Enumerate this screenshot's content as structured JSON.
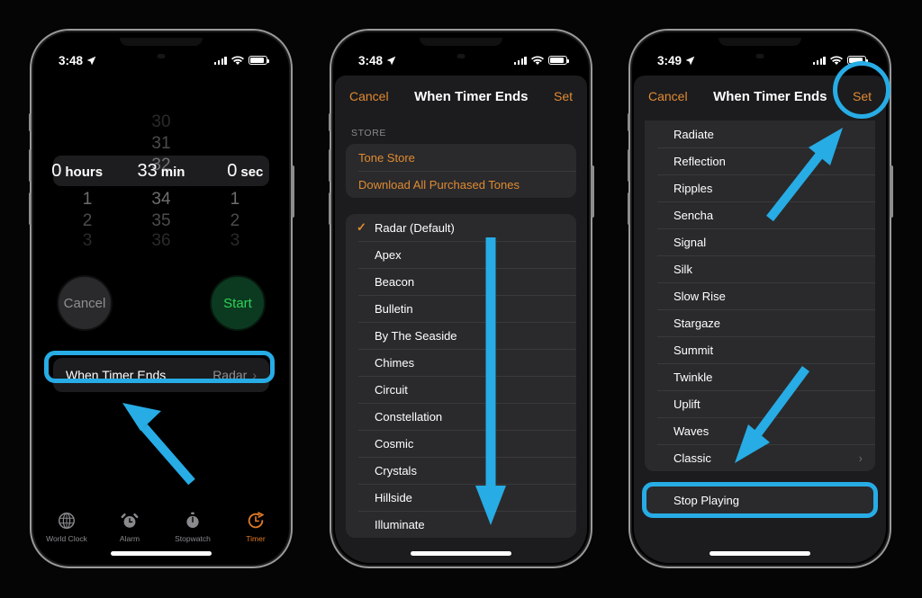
{
  "screens": [
    {
      "id": "timer",
      "status": {
        "time": "3:48",
        "location_icon": "location-arrow-icon",
        "signal": "signal-bars-icon",
        "wifi": "wifi-icon",
        "battery": "battery-icon"
      },
      "picker": {
        "hours": {
          "above": [
            "",
            "",
            ""
          ],
          "selected": "0",
          "unit": "hours",
          "below": [
            "1",
            "2",
            "3"
          ]
        },
        "minutes": {
          "above": [
            "30",
            "31",
            "32"
          ],
          "selected": "33",
          "unit": "min",
          "below": [
            "34",
            "35",
            "36"
          ]
        },
        "seconds": {
          "above": [
            "",
            "",
            ""
          ],
          "selected": "0",
          "unit": "sec",
          "below": [
            "1",
            "2",
            "3"
          ]
        }
      },
      "buttons": {
        "cancel": "Cancel",
        "start": "Start"
      },
      "when_timer_ends": {
        "label": "When Timer Ends",
        "value": "Radar",
        "chevron": "›"
      },
      "tabs": [
        {
          "label": "World Clock",
          "icon": "globe-icon",
          "active": false
        },
        {
          "label": "Alarm",
          "icon": "alarm-clock-icon",
          "active": false
        },
        {
          "label": "Stopwatch",
          "icon": "stopwatch-icon",
          "active": false
        },
        {
          "label": "Timer",
          "icon": "timer-icon",
          "active": true
        }
      ]
    },
    {
      "id": "tones-top",
      "status": {
        "time": "3:48"
      },
      "nav": {
        "cancel": "Cancel",
        "title": "When Timer Ends",
        "set": "Set"
      },
      "store_section_label": "STORE",
      "store_items": [
        "Tone Store",
        "Download All Purchased Tones"
      ],
      "tones": [
        {
          "name": "Radar (Default)",
          "selected": true
        },
        {
          "name": "Apex",
          "selected": false
        },
        {
          "name": "Beacon",
          "selected": false
        },
        {
          "name": "Bulletin",
          "selected": false
        },
        {
          "name": "By The Seaside",
          "selected": false
        },
        {
          "name": "Chimes",
          "selected": false
        },
        {
          "name": "Circuit",
          "selected": false
        },
        {
          "name": "Constellation",
          "selected": false
        },
        {
          "name": "Cosmic",
          "selected": false
        },
        {
          "name": "Crystals",
          "selected": false
        },
        {
          "name": "Hillside",
          "selected": false
        },
        {
          "name": "Illuminate",
          "selected": false
        }
      ]
    },
    {
      "id": "tones-bottom",
      "status": {
        "time": "3:49"
      },
      "nav": {
        "cancel": "Cancel",
        "title": "When Timer Ends",
        "set": "Set"
      },
      "tones": [
        {
          "name": "Radiate",
          "chevron": ""
        },
        {
          "name": "Reflection",
          "chevron": ""
        },
        {
          "name": "Ripples",
          "chevron": ""
        },
        {
          "name": "Sencha",
          "chevron": ""
        },
        {
          "name": "Signal",
          "chevron": ""
        },
        {
          "name": "Silk",
          "chevron": ""
        },
        {
          "name": "Slow Rise",
          "chevron": ""
        },
        {
          "name": "Stargaze",
          "chevron": ""
        },
        {
          "name": "Summit",
          "chevron": ""
        },
        {
          "name": "Twinkle",
          "chevron": ""
        },
        {
          "name": "Uplift",
          "chevron": ""
        },
        {
          "name": "Waves",
          "chevron": ""
        },
        {
          "name": "Classic",
          "chevron": "›"
        }
      ],
      "stop_playing": "Stop Playing"
    }
  ],
  "annotations": {
    "highlight_color": "#27ACE5",
    "accent_orange": "#e08a32",
    "start_green": "#30d158"
  }
}
